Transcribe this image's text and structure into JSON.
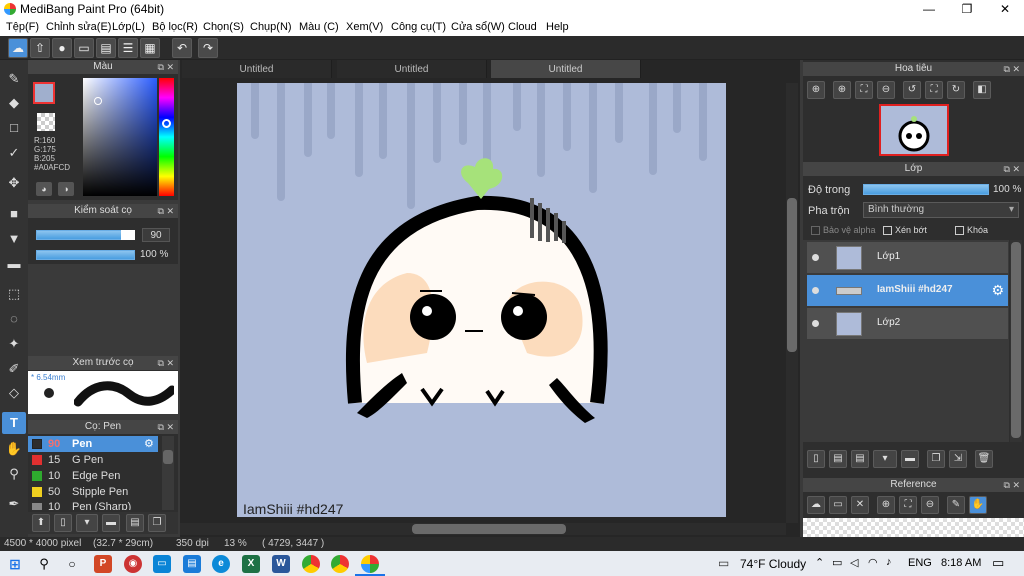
{
  "window": {
    "title": "MediBang Paint Pro (64bit)",
    "minimize": "—",
    "restore": "❐",
    "close": "✕"
  },
  "menu": [
    "Tệp(F)",
    "Chỉnh sửa(E)",
    "Lớp(L)",
    "Bộ lọc(R)",
    "Chọn(S)",
    "Chụp(N)",
    "Màu (C)",
    "Xem(V)",
    "Công cụ(T)",
    "Cửa sổ(W)",
    "Cloud",
    "Help"
  ],
  "color_panel": {
    "title": "Màu",
    "values": [
      "R:160",
      "G:175",
      "B:205",
      "#A0AFCD"
    ],
    "current_color": "#a0afcd"
  },
  "brush_control": {
    "title": "Kiểm soát cọ",
    "size": "90",
    "opacity": "100 %"
  },
  "brush_preview": {
    "title": "Xem trước cọ",
    "size_label": "* 6.54mm"
  },
  "brush_list": {
    "title": "Cọ: Pen",
    "items": [
      {
        "size": "90",
        "name": "Pen",
        "color": "#2e2e2e"
      },
      {
        "size": "15",
        "name": "G Pen",
        "color": "#e03030"
      },
      {
        "size": "10",
        "name": "Edge Pen",
        "color": "#2eaa2e"
      },
      {
        "size": "50",
        "name": "Stipple Pen",
        "color": "#f0d020"
      },
      {
        "size": "10",
        "name": "Pen (Sharp)",
        "color": "#888888"
      }
    ]
  },
  "tabs": [
    "Untitled",
    "Untitled",
    "Untitled"
  ],
  "canvas": {
    "watermark": "IamShiii #hd247"
  },
  "navigator": {
    "title": "Hoa tiêu"
  },
  "layers_panel": {
    "title": "Lớp",
    "opacity_label": "Độ trong",
    "opacity_value": "100 %",
    "blend_label": "Pha trộn",
    "blend_value": "Bình thường",
    "protect_alpha": "Bảo vệ alpha",
    "clipping": "Xén bớt",
    "lock": "Khóa",
    "layers": [
      {
        "name": "Lớp1",
        "selected": false
      },
      {
        "name": "IamShiii #hd247",
        "selected": true
      },
      {
        "name": "Lớp2",
        "selected": false
      }
    ]
  },
  "reference": {
    "title": "Reference"
  },
  "status": {
    "size": "4500 * 4000 pixel",
    "cm": "(32.7 * 29cm)",
    "dpi": "350 dpi",
    "zoom": "13 %",
    "coords": "( 4729, 3447 )"
  },
  "taskbar": {
    "weather": "74°F  Cloudy",
    "lang": "ENG",
    "time": "8:18 AM"
  }
}
